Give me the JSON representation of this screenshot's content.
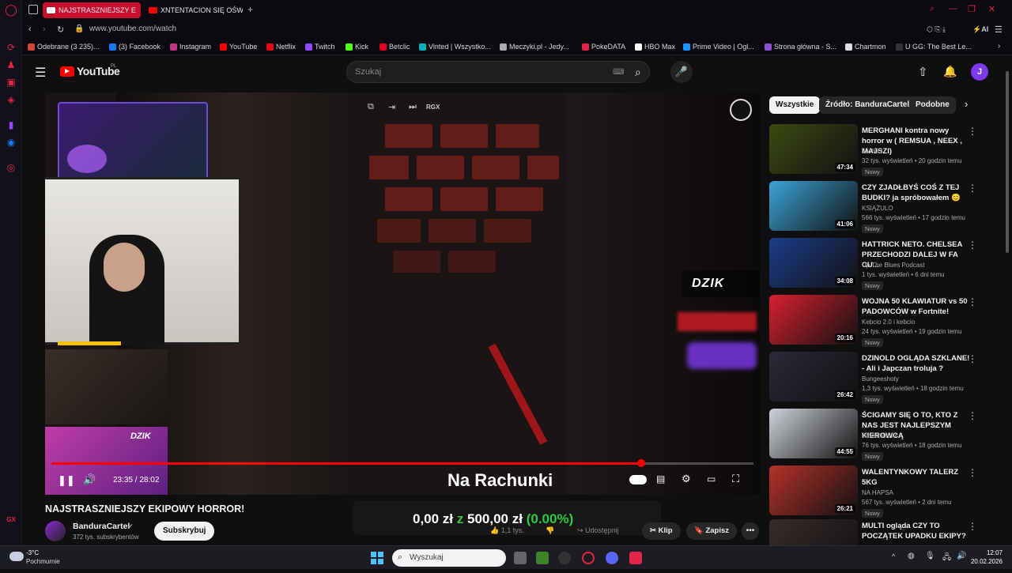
{
  "tabs": [
    {
      "label": "NAJSTRASZNIEJSZY E",
      "active": true
    },
    {
      "label": "XNTENTACION SIĘ OŚWIA",
      "active": false
    }
  ],
  "url": "www.youtube.com/watch",
  "bookmarks": [
    "Odebrane (3 235)...",
    "(3) Facebook",
    "Instagram",
    "YouTube",
    "Netflix",
    "Twitch",
    "Kick",
    "Betclic",
    "Vinted | Wszystko...",
    "Meczyki.pl - Jedy...",
    "PokeDATA",
    "HBO Max",
    "Prime Video | Ogl...",
    "Strona główna - S...",
    "Chartmon",
    "U GG: The Best Le..."
  ],
  "header": {
    "logo": "YouTube",
    "logo_region": "PL",
    "search_placeholder": "Szukaj",
    "avatar_letter": "J"
  },
  "player": {
    "overlay_buttons": [
      "RGX"
    ],
    "brand_text": "DZIK",
    "time": "23:35 / 28:02",
    "progress": 0.84,
    "caption": "Na Rachunki",
    "donation": {
      "current": "0,00 zł",
      "sep": "z",
      "goal": "500,00 zł",
      "pct": "(0.00%)"
    }
  },
  "video": {
    "title": "NAJSTRASZNIEJSZY EKIPOWY HORROR!",
    "channel": "BanduraCartel",
    "subs": "372 tys. subskrybentów",
    "subscribe": "Subskrybuj",
    "likes": "1,1 tys.",
    "share": "Udostępnij",
    "clip": "Klip",
    "save": "Zapisz"
  },
  "chips": [
    "Wszystkie",
    "Źródło: BanduraCartel",
    "Podobne"
  ],
  "recs": [
    {
      "title": "MERGHANI kontra nowy horror w ( REMSUA , NEEX , MAJSZI)",
      "channel": "JAPKO",
      "meta": "32 tys. wyświetleń • 20 godzin temu",
      "duration": "47:34",
      "badge": "Nowy",
      "color": "#3d4a12"
    },
    {
      "title": "CZY ZJADŁBYŚ COŚ Z TEJ BUDKI? ja spróbowałem 😊",
      "channel": "KSIĄŻULO",
      "meta": "566 tys. wyświetleń • 17 godzin temu",
      "duration": "41:06",
      "badge": "Nowy",
      "color": "#3aa5d8"
    },
    {
      "title": "HATTRICK NETO. CHELSEA PRZECHODZI DALEJ W FA CU...",
      "channel": "Up The Blues Podcast",
      "meta": "1 tys. wyświetleń • 6 dni temu",
      "duration": "34:08",
      "badge": "Nowy",
      "color": "#1c3d8a"
    },
    {
      "title": "WOJNA 50 KLAWIATUR vs 50 PADOWCÓW w Fortnite!",
      "channel": "Kebcio 2.0 i kebcio",
      "meta": "24 tys. wyświetleń • 19 godzin temu",
      "duration": "20:16",
      "badge": "Nowy",
      "color": "#d8202f"
    },
    {
      "title": "DZINOLD OGLĄDA SZKLANE! - Ali i Japczan troluja ?",
      "channel": "Bungeeshoty",
      "meta": "1,3 tys. wyświetleń • 18 godzin temu",
      "duration": "26:42",
      "badge": "Nowy",
      "color": "#2a2a3a"
    },
    {
      "title": "ŚCIGAMY SIĘ O TO, KTO Z NAS JEST NAJLEPSZYM KIEROWCĄ",
      "channel": "Wheel with it.",
      "meta": "76 tys. wyświetleń • 18 godzin temu",
      "duration": "44:55",
      "badge": "Nowy",
      "color": "#cfd3da"
    },
    {
      "title": "WALENTYNKOWY TALERZ 5KG",
      "channel": "NA HAPSA",
      "meta": "567 tys. wyświetleń • 2 dni temu",
      "duration": "26:21",
      "badge": "Nowy",
      "color": "#b5322a"
    },
    {
      "title": "MULTI ogląda CZY TO POCZĄTEK UPADKU EKIPY?",
      "channel": "",
      "meta": "",
      "duration": "",
      "badge": "",
      "color": "#3a2b2b"
    }
  ],
  "taskbar": {
    "weather_temp": "-3°C",
    "weather_desc": "Pochmurnie",
    "search": "Wyszukaj",
    "time": "12:07",
    "date": "20.02.2026"
  }
}
